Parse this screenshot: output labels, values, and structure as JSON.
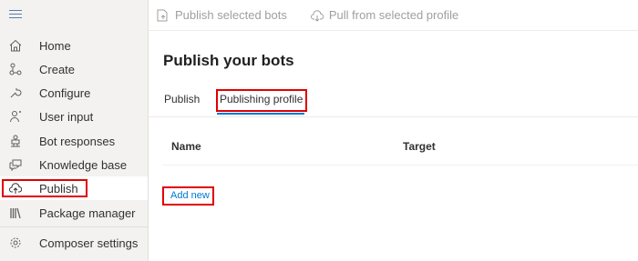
{
  "sidebar": {
    "items": [
      {
        "label": "Home",
        "icon": "home-icon"
      },
      {
        "label": "Create",
        "icon": "create-icon"
      },
      {
        "label": "Configure",
        "icon": "wrench-icon"
      },
      {
        "label": "User input",
        "icon": "user-input-icon"
      },
      {
        "label": "Bot responses",
        "icon": "bot-icon"
      },
      {
        "label": "Knowledge base",
        "icon": "chat-icon"
      },
      {
        "label": "Publish",
        "icon": "cloud-upload-icon",
        "active": true
      },
      {
        "label": "Package manager",
        "icon": "library-icon"
      },
      {
        "label": "Composer settings",
        "icon": "gear-icon"
      }
    ]
  },
  "toolbar": {
    "publish_selected_label": "Publish selected bots",
    "pull_profile_label": "Pull from selected profile"
  },
  "main": {
    "title": "Publish your bots",
    "tabs": [
      {
        "label": "Publish"
      },
      {
        "label": "Publishing profile",
        "selected": true
      }
    ],
    "columns": [
      "Name",
      "Target"
    ],
    "add_new_label": "Add new"
  },
  "colors": {
    "accent": "#0078d4",
    "highlight": "#e00000",
    "sidebar_bg": "#f3f2f1"
  }
}
